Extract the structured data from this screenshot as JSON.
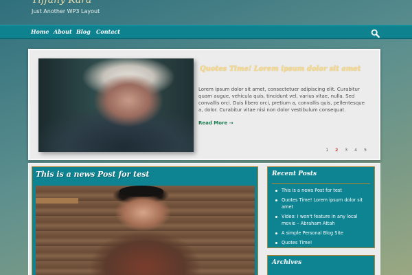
{
  "site": {
    "title": "Tiffany Kara",
    "tagline": "Just Another WP3 Layout"
  },
  "nav": {
    "items": [
      "Home",
      "About",
      "Blog",
      "Contact"
    ],
    "search_icon": "search-icon"
  },
  "slider": {
    "title": "Quotes Time! Lorem ipsum dolor sit amet",
    "excerpt": "Lorem ipsum dolor sit amet, consectetuer adipiscing elit. Curabitur quam augue, vehicula quis, tincidunt vel, varius vitae, nulla. Sed convallis orci. Duis libero orci, pretium a, convallis quis, pellentesque a, dolor. Curabitur vitae nisi non dolor vestibulum consequat.",
    "read_more": "Read More →",
    "pages": [
      "1",
      "2",
      "3",
      "4",
      "5"
    ],
    "active_page": "2"
  },
  "post": {
    "title": "This is a news Post for test"
  },
  "recent_posts": {
    "title": "Recent Posts",
    "items": [
      "This is a news Post for test",
      "Quotes Time! Lorem ipsum dolor sit amet",
      "Video: I won't feature in any local movie – Abraham Attah",
      "A simple Personal Blog Site",
      "Quotes Time!"
    ]
  },
  "archives": {
    "title": "Archives"
  },
  "colors": {
    "accent": "#0e8391",
    "border_gold": "#b0842f",
    "slide_title": "#f6d98a",
    "read_more": "#1a7a50",
    "pager_active": "#d63a3a"
  }
}
